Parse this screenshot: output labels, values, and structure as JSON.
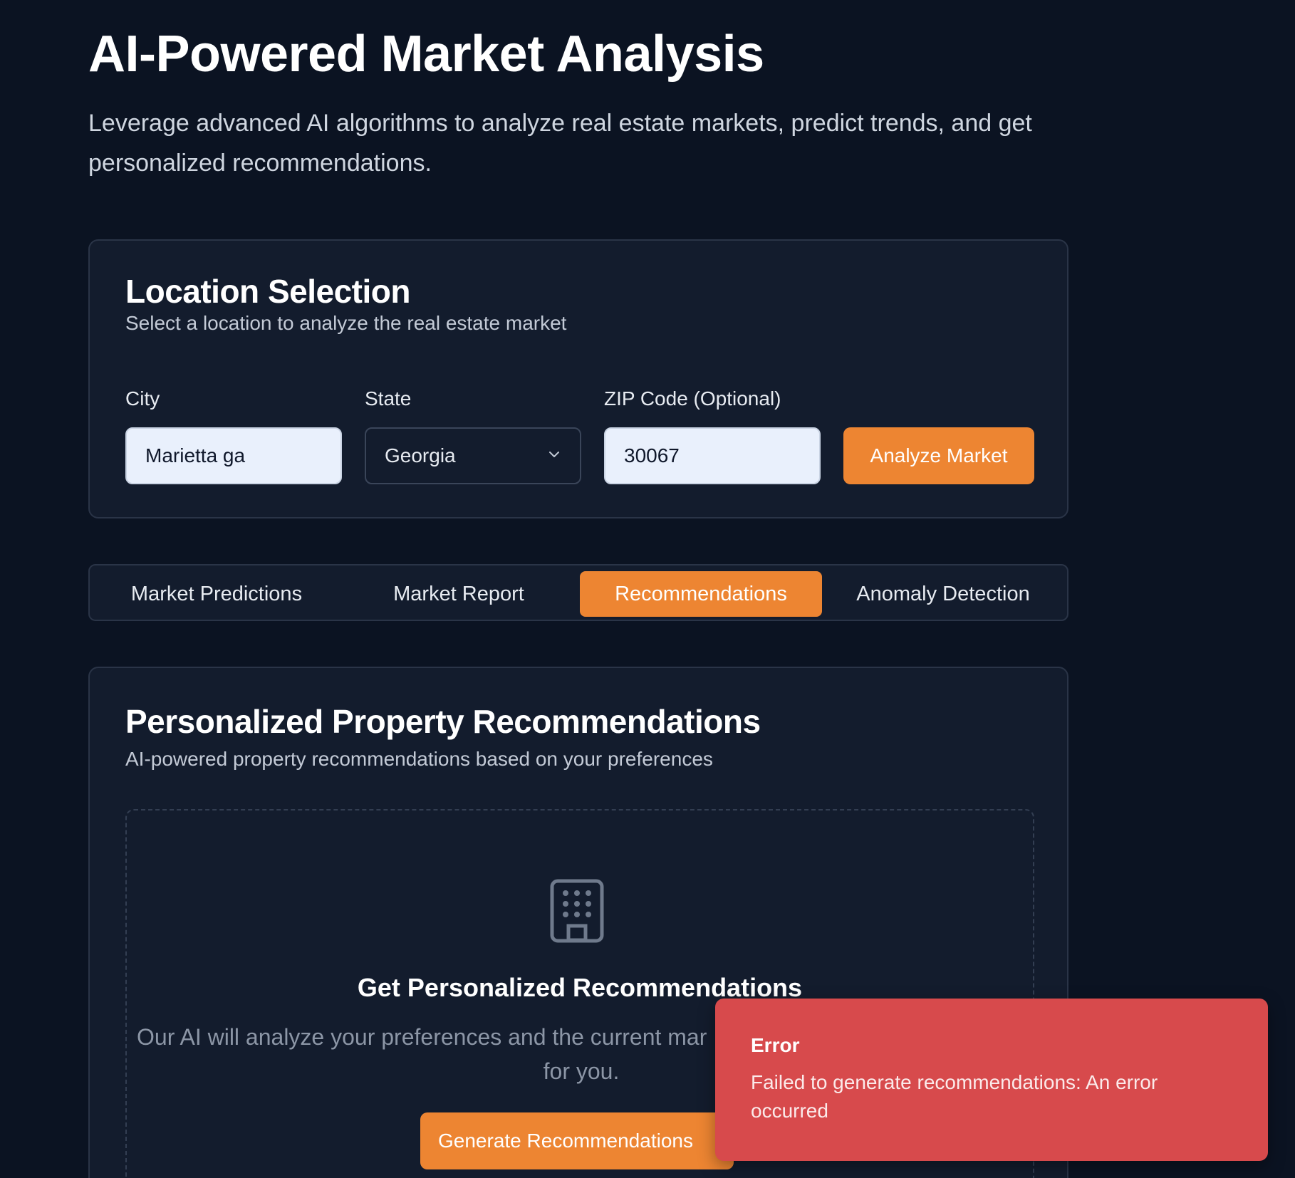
{
  "header": {
    "title": "AI-Powered Market Analysis",
    "subtitle": "Leverage advanced AI algorithms to analyze real estate markets, predict trends, and get personalized recommendations."
  },
  "location": {
    "title": "Location Selection",
    "description": "Select a location to analyze the real estate market",
    "city_label": "City",
    "city_value": "Marietta ga",
    "state_label": "State",
    "state_value": "Georgia",
    "zip_label": "ZIP Code (Optional)",
    "zip_value": "30067",
    "analyze_button": "Analyze Market"
  },
  "tabs": [
    {
      "label": "Market Predictions",
      "active": false
    },
    {
      "label": "Market Report",
      "active": false
    },
    {
      "label": "Recommendations",
      "active": true
    },
    {
      "label": "Anomaly Detection",
      "active": false
    }
  ],
  "recommendations": {
    "title": "Personalized Property Recommendations",
    "description": "AI-powered property recommendations based on your preferences",
    "empty_icon": "building-icon",
    "empty_title": "Get Personalized Recommendations",
    "empty_text": "Our AI will analyze your preferences and the current mar",
    "empty_text_line2": "for you.",
    "generate_button": "Generate Recommendations"
  },
  "toast": {
    "title": "Error",
    "message": "Failed to generate recommendations: An error occurred"
  },
  "colors": {
    "background": "#0b1322",
    "card": "#131c2d",
    "accent": "#ed8532",
    "error": "#d74a4c"
  }
}
